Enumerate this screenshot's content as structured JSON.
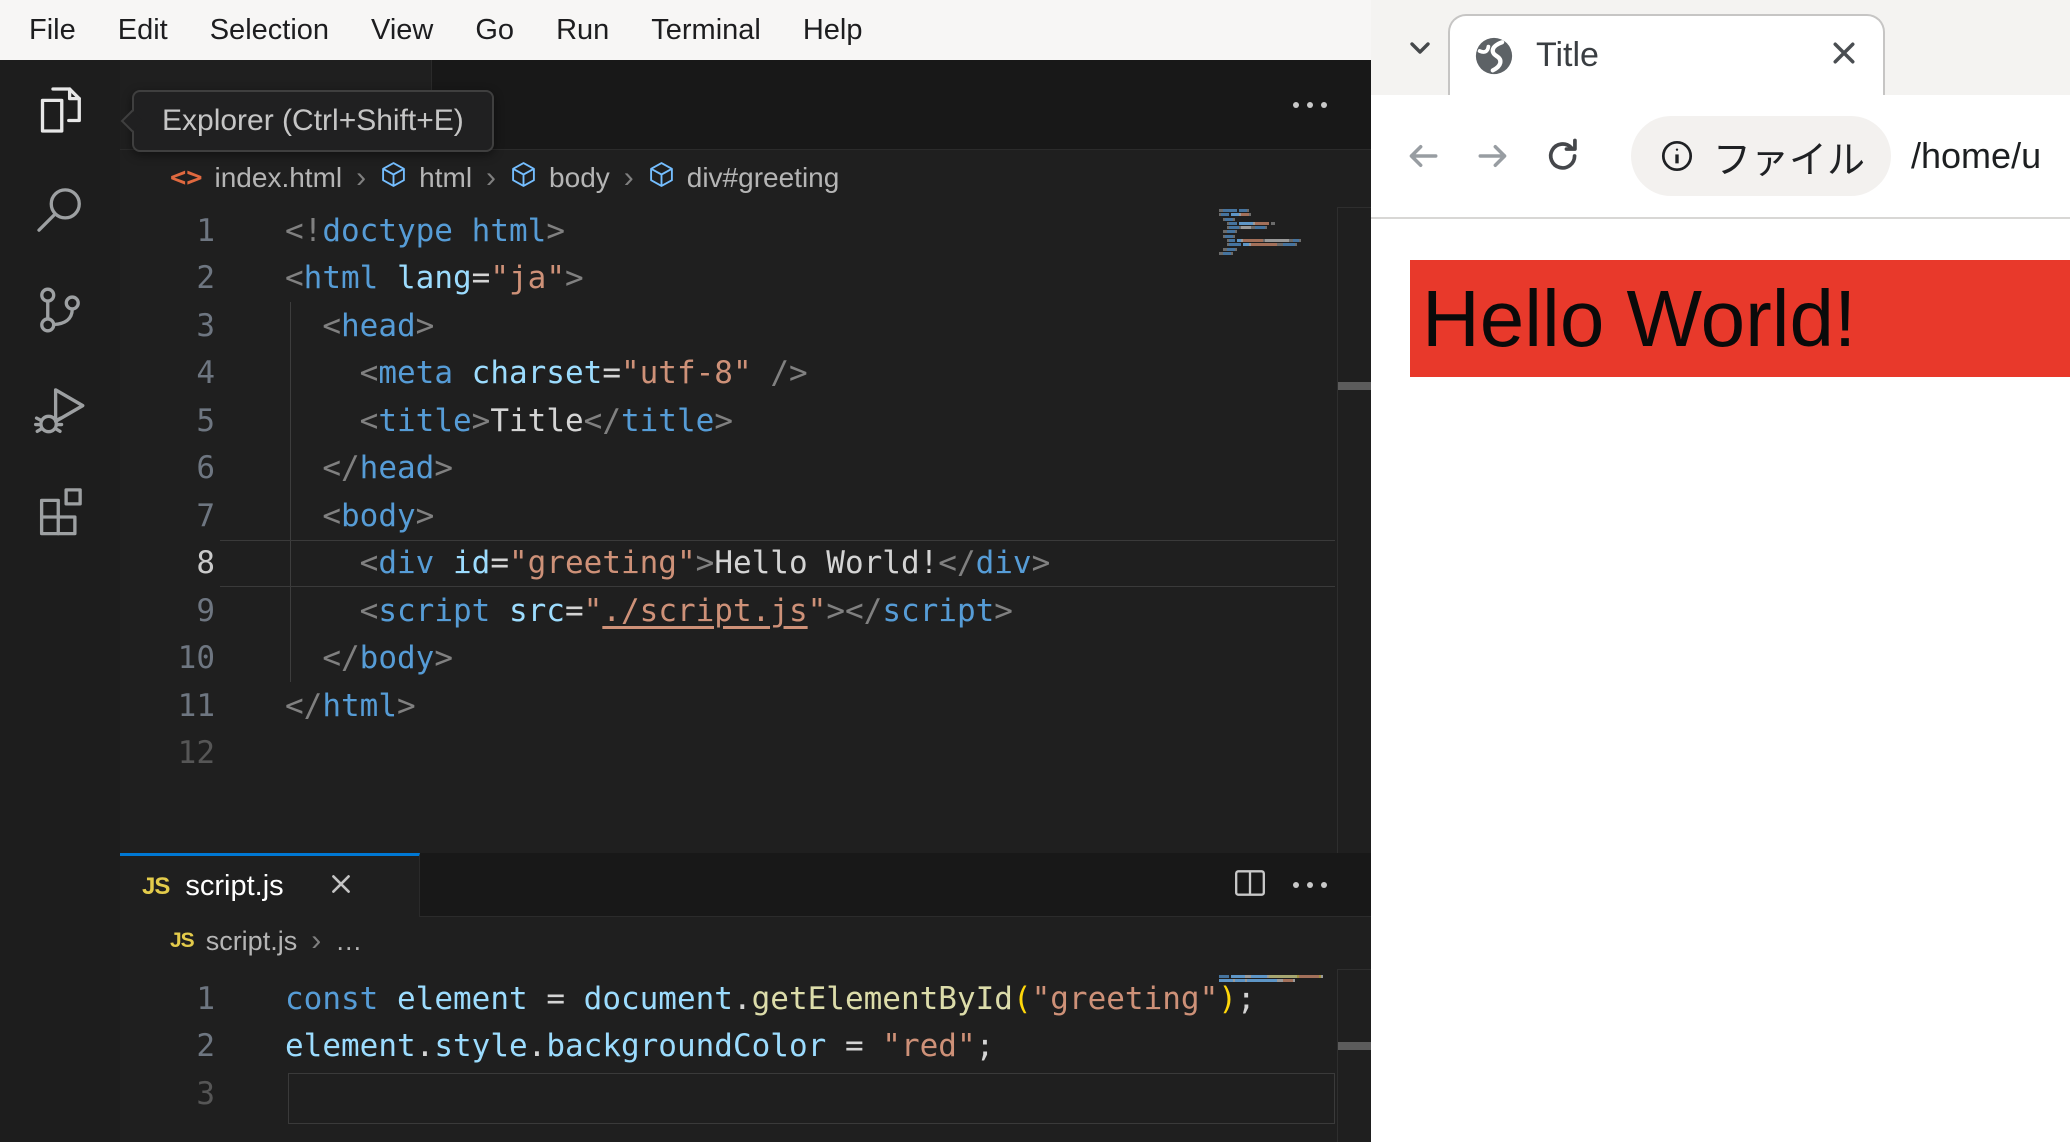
{
  "vscode": {
    "menu_items": [
      "File",
      "Edit",
      "Selection",
      "View",
      "Go",
      "Run",
      "Terminal",
      "Help"
    ],
    "tooltip": "Explorer (Ctrl+Shift+E)",
    "icons": {
      "html_file": "<>",
      "crumb_sep": "›"
    },
    "editor1": {
      "breadcrumb": {
        "file": "index.html",
        "seg1": "html",
        "seg2": "body",
        "seg3": "div#greeting"
      },
      "lines": [
        {
          "num": "1",
          "tokens": [
            [
              "punct",
              "<!"
            ],
            [
              "tag",
              "doctype"
            ],
            [
              "plain",
              " "
            ],
            [
              "tag",
              "html"
            ],
            [
              "punct",
              ">"
            ]
          ]
        },
        {
          "num": "2",
          "tokens": [
            [
              "punct",
              "<"
            ],
            [
              "tag",
              "html"
            ],
            [
              "plain",
              " "
            ],
            [
              "attr",
              "lang"
            ],
            [
              "plain",
              "="
            ],
            [
              "str",
              "\"ja\""
            ],
            [
              "punct",
              ">"
            ]
          ]
        },
        {
          "num": "3",
          "tokens": [
            [
              "plain",
              "  "
            ],
            [
              "punct",
              "<"
            ],
            [
              "tag",
              "head"
            ],
            [
              "punct",
              ">"
            ]
          ]
        },
        {
          "num": "4",
          "tokens": [
            [
              "plain",
              "    "
            ],
            [
              "punct",
              "<"
            ],
            [
              "tag",
              "meta"
            ],
            [
              "plain",
              " "
            ],
            [
              "attr",
              "charset"
            ],
            [
              "plain",
              "="
            ],
            [
              "str",
              "\"utf-8\""
            ],
            [
              "plain",
              " "
            ],
            [
              "punct",
              "/>"
            ]
          ]
        },
        {
          "num": "5",
          "tokens": [
            [
              "plain",
              "    "
            ],
            [
              "punct",
              "<"
            ],
            [
              "tag",
              "title"
            ],
            [
              "punct",
              ">"
            ],
            [
              "plain",
              "Title"
            ],
            [
              "punct",
              "</"
            ],
            [
              "tag",
              "title"
            ],
            [
              "punct",
              ">"
            ]
          ]
        },
        {
          "num": "6",
          "tokens": [
            [
              "plain",
              "  "
            ],
            [
              "punct",
              "</"
            ],
            [
              "tag",
              "head"
            ],
            [
              "punct",
              ">"
            ]
          ]
        },
        {
          "num": "7",
          "tokens": [
            [
              "plain",
              "  "
            ],
            [
              "punct",
              "<"
            ],
            [
              "tag",
              "body"
            ],
            [
              "punct",
              ">"
            ]
          ]
        },
        {
          "num": "8",
          "ns": "hi",
          "cur": true,
          "tokens": [
            [
              "plain",
              "    "
            ],
            [
              "punct",
              "<"
            ],
            [
              "tag",
              "div"
            ],
            [
              "plain",
              " "
            ],
            [
              "attr",
              "id"
            ],
            [
              "plain",
              "="
            ],
            [
              "str",
              "\"greeting\""
            ],
            [
              "punct",
              ">"
            ],
            [
              "plain",
              "Hello World!"
            ],
            [
              "punct",
              "</"
            ],
            [
              "tag",
              "div"
            ],
            [
              "punct",
              ">"
            ]
          ]
        },
        {
          "num": "9",
          "tokens": [
            [
              "plain",
              "    "
            ],
            [
              "punct",
              "<"
            ],
            [
              "tag",
              "script"
            ],
            [
              "plain",
              " "
            ],
            [
              "attr",
              "src"
            ],
            [
              "plain",
              "="
            ],
            [
              "str",
              "\""
            ],
            [
              "link",
              "./script.js"
            ],
            [
              "str",
              "\""
            ],
            [
              "punct",
              "></"
            ],
            [
              "tag",
              "script"
            ],
            [
              "punct",
              ">"
            ]
          ]
        },
        {
          "num": "10",
          "tokens": [
            [
              "plain",
              "  "
            ],
            [
              "punct",
              "</"
            ],
            [
              "tag",
              "body"
            ],
            [
              "punct",
              ">"
            ]
          ]
        },
        {
          "num": "11",
          "tokens": [
            [
              "punct",
              "</"
            ],
            [
              "tag",
              "html"
            ],
            [
              "punct",
              ">"
            ]
          ]
        },
        {
          "num": "12",
          "ns": "lo",
          "tokens": []
        }
      ]
    },
    "panel": {
      "tab_icon": "JS",
      "tab_label": "script.js",
      "breadcrumb": {
        "icon": "JS",
        "file": "script.js",
        "more": "…"
      }
    },
    "editor2": {
      "lines": [
        {
          "num": "1",
          "tokens": [
            [
              "kw",
              "const"
            ],
            [
              "plain",
              " "
            ],
            [
              "attr",
              "element"
            ],
            [
              "plain",
              " = "
            ],
            [
              "attr",
              "document"
            ],
            [
              "plain",
              "."
            ],
            [
              "fn",
              "getElementById"
            ],
            [
              "brkt",
              "("
            ],
            [
              "str",
              "\"greeting\""
            ],
            [
              "brkt",
              ")"
            ],
            [
              "plain",
              ";"
            ]
          ]
        },
        {
          "num": "2",
          "tokens": [
            [
              "attr",
              "element"
            ],
            [
              "plain",
              "."
            ],
            [
              "attr",
              "style"
            ],
            [
              "plain",
              "."
            ],
            [
              "attr",
              "backgroundColor"
            ],
            [
              "plain",
              " = "
            ],
            [
              "str",
              "\"red\""
            ],
            [
              "plain",
              ";"
            ]
          ]
        },
        {
          "num": "3",
          "ns": "lo",
          "cur": true,
          "tokens": []
        }
      ]
    }
  },
  "browser": {
    "tab_title": "Title",
    "url_chip": "ファイル",
    "url": "/home/u",
    "page_text": "Hello World!",
    "page_bg": "#e8392b"
  }
}
